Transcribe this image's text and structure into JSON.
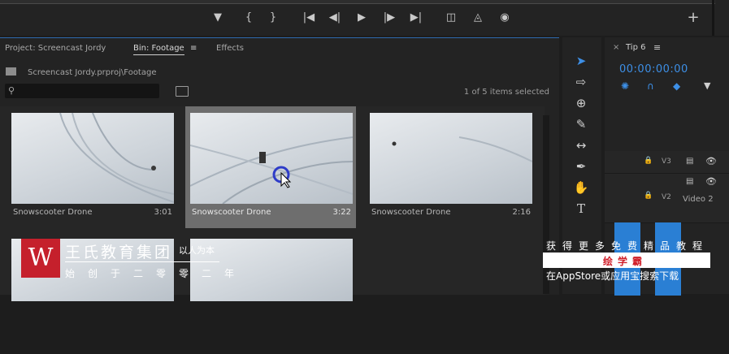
{
  "project_panel": {
    "tabs": [
      {
        "label": "Project: Screencast Jordy"
      },
      {
        "label": "Bin: Footage"
      },
      {
        "label": "Effects"
      }
    ],
    "path": "Screencast Jordy.prproj\\Footage",
    "search_value": "",
    "items_count": "1 of 5 items selected",
    "clips": [
      {
        "name": "Snowscooter Drone",
        "duration": "3:01"
      },
      {
        "name": "Snowscooter Drone",
        "duration": "3:22"
      },
      {
        "name": "Snowscooter Drone",
        "duration": "2:16"
      }
    ]
  },
  "timeline": {
    "tab_label": "Tip 6",
    "timecode": "00:00:00:00",
    "tracks": [
      {
        "label": "V3",
        "name": ""
      },
      {
        "label": "V2",
        "name": "Video 2"
      }
    ]
  },
  "watermark": {
    "logo_letter": "W",
    "title": "王氏教育集团",
    "motto": "以人为本",
    "subtitle": "始创于二零零二年"
  },
  "promo": {
    "line1": "获得更多免费精品教程",
    "brand": "绘学霸",
    "line3": "在AppStore或应用宝搜索下载"
  },
  "colors": {
    "accent": "#3d8fe6",
    "selection": "#6e6e6e",
    "watermark_red": "#c5202c"
  }
}
